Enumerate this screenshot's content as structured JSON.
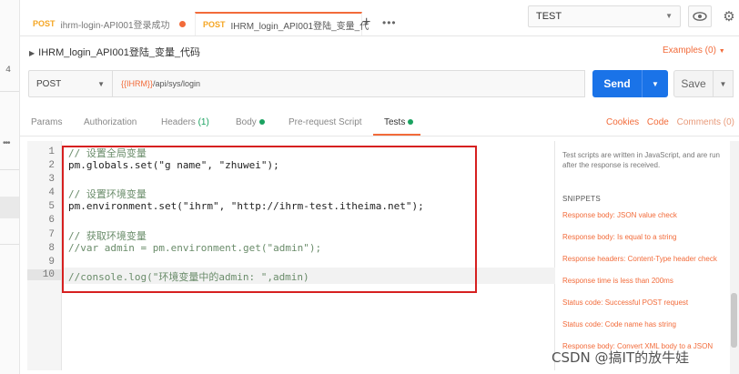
{
  "left_strip": {
    "number": "4"
  },
  "tabs": [
    {
      "method": "POST",
      "title": "ihrm-login-API001登录成功"
    },
    {
      "method": "POST",
      "title": "IHRM_login_API001登陆_变量_代"
    }
  ],
  "env": {
    "selected": "TEST"
  },
  "request": {
    "name": "IHRM_login_API001登陆_变量_代码",
    "examples_label": "Examples (0)",
    "method": "POST",
    "url_var": "{{IHRM}}",
    "url_path": "/api/sys/login",
    "send_label": "Send",
    "save_label": "Save"
  },
  "subtabs": {
    "params": "Params",
    "authorization": "Authorization",
    "headers": "Headers",
    "headers_count": "(1)",
    "body": "Body",
    "prerequest": "Pre-request Script",
    "tests": "Tests",
    "cookies": "Cookies",
    "code": "Code",
    "comments": "Comments (0)"
  },
  "editor": {
    "line_numbers": [
      "1",
      "2",
      "3",
      "4",
      "5",
      "6",
      "7",
      "8",
      "9",
      "10"
    ],
    "lines": [
      "// 设置全局变量",
      "pm.globals.set(\"g name\", \"zhuwei\");",
      "",
      "// 设置环境变量",
      "pm.environment.set(\"ihrm\", \"http://ihrm-test.itheima.net\");",
      "",
      "// 获取环境变量",
      "//var admin = pm.environment.get(\"admin\");",
      "",
      "//console.log(\"环境变量中的admin: \",admin)"
    ]
  },
  "right_panel": {
    "description": "Test scripts are written in JavaScript, and are run after the response is received.",
    "snippets_heading": "SNIPPETS",
    "snippets": [
      "Response body: JSON value check",
      "Response body: Is equal to a string",
      "Response headers: Content-Type header check",
      "Response time is less than 200ms",
      "Status code: Successful POST request",
      "Status code: Code name has string",
      "Response body: Convert XML body to a JSON"
    ]
  },
  "watermark": "CSDN @搞IT的放牛娃",
  "colors": {
    "accent": "#f26b3a",
    "primary": "#1a73e8",
    "highlight_box": "#d62020"
  }
}
